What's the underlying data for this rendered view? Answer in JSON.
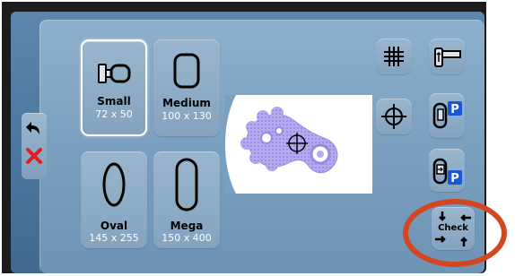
{
  "hoops": {
    "small": {
      "name": "Small",
      "size": "72 x 50",
      "selected": true
    },
    "medium": {
      "name": "Medium",
      "size": "100 x 130",
      "selected": false
    },
    "oval": {
      "name": "Oval",
      "size": "145 x 255",
      "selected": false
    },
    "mega": {
      "name": "Mega",
      "size": "150 x 400",
      "selected": false
    }
  },
  "buttons": {
    "check_label": "Check",
    "parking_badge": "P"
  },
  "icons": {
    "back": "undo-arrow-icon",
    "cancel": "red-x-icon",
    "grid": "grid-icon",
    "crosshair": "crosshair-icon",
    "hoop_side": "hoop-clamp-icon",
    "park_hoop": "park-hoop-icon",
    "park_hoop_side": "park-hoop-side-icon",
    "check": "check-arrows-icon"
  },
  "colors": {
    "panel_outer": "#4a769f",
    "panel_inner": "#7b9fbf",
    "selected_border": "#ffffff",
    "embroidery": "#a593e8",
    "highlight_ring": "#d2471f",
    "cancel_red": "#e02020",
    "parking_blue": "#1a57d6"
  }
}
